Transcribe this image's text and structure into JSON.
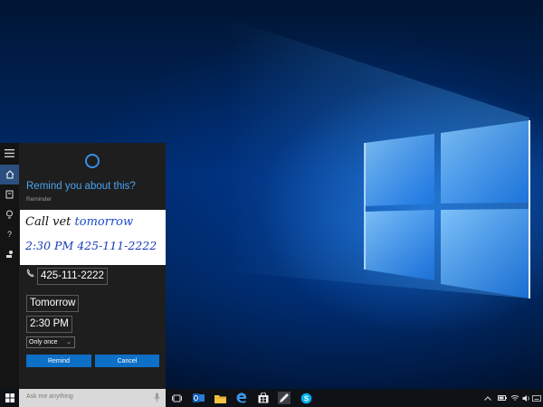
{
  "cortana": {
    "prompt": "Remind you about this?",
    "reminder_label": "Reminder",
    "ink": {
      "line1_a": "Call vet ",
      "line1_b": "tomorrow",
      "line2": "2:30 PM   425-111-2222"
    },
    "phone_value": "425-111-2222",
    "day_value": "Tomorrow",
    "time_value": "2:30 PM",
    "repeat_value": "Only once",
    "remind_label": "Remind",
    "cancel_label": "Cancel"
  },
  "taskbar": {
    "search_placeholder": "Ask me anything",
    "pinned_icons": [
      "task-view-icon",
      "outlook-icon",
      "file-explorer-icon",
      "edge-icon",
      "store-icon",
      "ink-workspace-icon",
      "skype-icon"
    ],
    "tray_icons": [
      "chevron-up-icon",
      "battery-icon",
      "wifi-icon",
      "volume-icon",
      "keyboard-icon",
      "action-center-icon"
    ]
  },
  "colors": {
    "accent": "#0e6fc7",
    "cortana_blue": "#4aa3f0",
    "panel_bg": "#1e1e1e",
    "taskbar_bg": "#0e1116"
  }
}
